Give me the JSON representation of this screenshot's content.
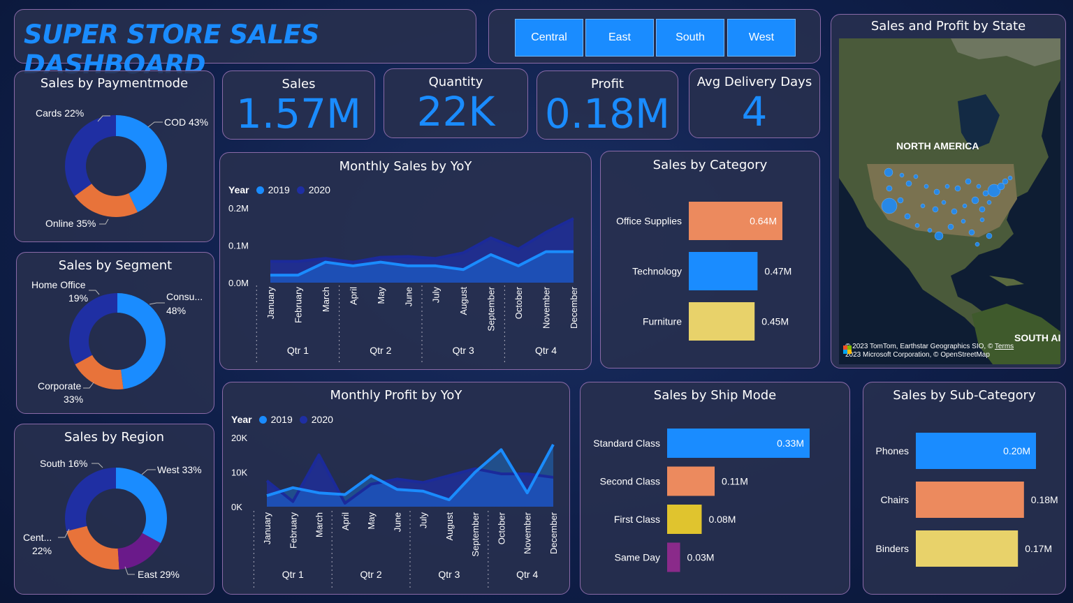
{
  "header": {
    "title": "SUPER STORE SALES DASHBOARD"
  },
  "slicer": {
    "items": [
      "Central",
      "East",
      "South",
      "West"
    ]
  },
  "kpis": {
    "sales": {
      "label": "Sales",
      "value": "1.57M"
    },
    "quantity": {
      "label": "Quantity",
      "value": "22K"
    },
    "profit": {
      "label": "Profit",
      "value": "0.18M"
    },
    "delivery": {
      "label": "Avg Delivery Days",
      "value": "4"
    }
  },
  "colors": {
    "blue": "#1a8cff",
    "navy": "#1f2fa3",
    "orange": "#e8733a",
    "purple": "#6a1a8a",
    "salmon": "#ec8a5e",
    "yellow": "#e8d26a",
    "gold": "#e0c42e",
    "violet": "#8a2a8a"
  },
  "payment": {
    "title": "Sales by Paymentmode",
    "labels": {
      "cod": "COD 43%",
      "cards": "Cards 22%",
      "online": "Online 35%"
    }
  },
  "segment": {
    "title": "Sales by Segment",
    "labels": {
      "consumer_name": "Consu...",
      "consumer_pct": "48%",
      "home_name": "Home Office",
      "home_pct": "19%",
      "corp_name": "Corporate",
      "corp_pct": "33%"
    }
  },
  "region": {
    "title": "Sales by Region",
    "labels": {
      "west": "West 33%",
      "south": "South 16%",
      "central_name": "Cent...",
      "central_pct": "22%",
      "east": "East 29%"
    }
  },
  "map": {
    "title": "Sales and Profit by State",
    "label_na": "NORTH AMERICA",
    "label_sa": "SOUTH AI",
    "attribution1": "© 2023 TomTom, Earthstar Geographics SIO, ©",
    "attribution2": "2023 Microsoft Corporation, © OpenStreetMap",
    "terms": "Terms"
  },
  "monthly_sales": {
    "title": "Monthly Sales by YoY",
    "legend_title": "Year",
    "legend": [
      "2019",
      "2020"
    ]
  },
  "monthly_profit": {
    "title": "Monthly Profit by YoY",
    "legend_title": "Year",
    "legend": [
      "2019",
      "2020"
    ]
  },
  "category": {
    "title": "Sales by Category"
  },
  "ship_mode": {
    "title": "Sales by Ship Mode"
  },
  "sub_category": {
    "title": "Sales by Sub-Category"
  },
  "chart_data": [
    {
      "id": "payment",
      "type": "pie",
      "categories": [
        "COD",
        "Cards",
        "Online"
      ],
      "values": [
        43,
        22,
        35
      ]
    },
    {
      "id": "segment",
      "type": "pie",
      "categories": [
        "Consumer",
        "Home Office",
        "Corporate"
      ],
      "values": [
        48,
        19,
        33
      ]
    },
    {
      "id": "region",
      "type": "pie",
      "categories": [
        "West",
        "South",
        "Central",
        "East"
      ],
      "values": [
        33,
        16,
        22,
        29
      ]
    },
    {
      "id": "monthly_sales",
      "type": "area",
      "categories": [
        "January",
        "February",
        "March",
        "April",
        "May",
        "June",
        "July",
        "August",
        "September",
        "October",
        "November",
        "December"
      ],
      "quarters": [
        "Qtr 1",
        "Qtr 2",
        "Qtr 3",
        "Qtr 4"
      ],
      "series": [
        {
          "name": "2019",
          "values": [
            0.02,
            0.02,
            0.055,
            0.045,
            0.055,
            0.045,
            0.045,
            0.035,
            0.075,
            0.045,
            0.083,
            0.083
          ]
        },
        {
          "name": "2020",
          "values": [
            0.057,
            0.057,
            0.065,
            0.055,
            0.068,
            0.07,
            0.065,
            0.08,
            0.12,
            0.09,
            0.135,
            0.172
          ]
        }
      ],
      "yticks": [
        "0.0M",
        "0.1M",
        "0.2M"
      ],
      "ylim": [
        0,
        0.2
      ]
    },
    {
      "id": "monthly_profit",
      "type": "area",
      "categories": [
        "January",
        "February",
        "March",
        "April",
        "May",
        "June",
        "July",
        "August",
        "September",
        "October",
        "November",
        "December"
      ],
      "quarters": [
        "Qtr 1",
        "Qtr 2",
        "Qtr 3",
        "Qtr 4"
      ],
      "series": [
        {
          "name": "2019",
          "values": [
            3200,
            5500,
            4000,
            3500,
            9000,
            5000,
            4500,
            2000,
            10000,
            16500,
            4000,
            18000
          ]
        },
        {
          "name": "2020",
          "values": [
            7500,
            1500,
            15000,
            1000,
            6500,
            8000,
            7000,
            9000,
            11000,
            9500,
            9500,
            8500
          ]
        }
      ],
      "yticks": [
        "0K",
        "10K",
        "20K"
      ],
      "ylim": [
        0,
        20000
      ]
    },
    {
      "id": "category",
      "type": "bar",
      "categories": [
        "Office Supplies",
        "Technology",
        "Furniture"
      ],
      "values": [
        0.64,
        0.47,
        0.45
      ],
      "labels": [
        "0.64M",
        "0.47M",
        "0.45M"
      ]
    },
    {
      "id": "ship_mode",
      "type": "bar",
      "categories": [
        "Standard Class",
        "Second Class",
        "First Class",
        "Same Day"
      ],
      "values": [
        0.33,
        0.11,
        0.08,
        0.03
      ],
      "labels": [
        "0.33M",
        "0.11M",
        "0.08M",
        "0.03M"
      ]
    },
    {
      "id": "sub_category",
      "type": "bar",
      "categories": [
        "Phones",
        "Chairs",
        "Binders"
      ],
      "values": [
        0.2,
        0.18,
        0.17
      ],
      "labels": [
        "0.20M",
        "0.18M",
        "0.17M"
      ]
    }
  ]
}
